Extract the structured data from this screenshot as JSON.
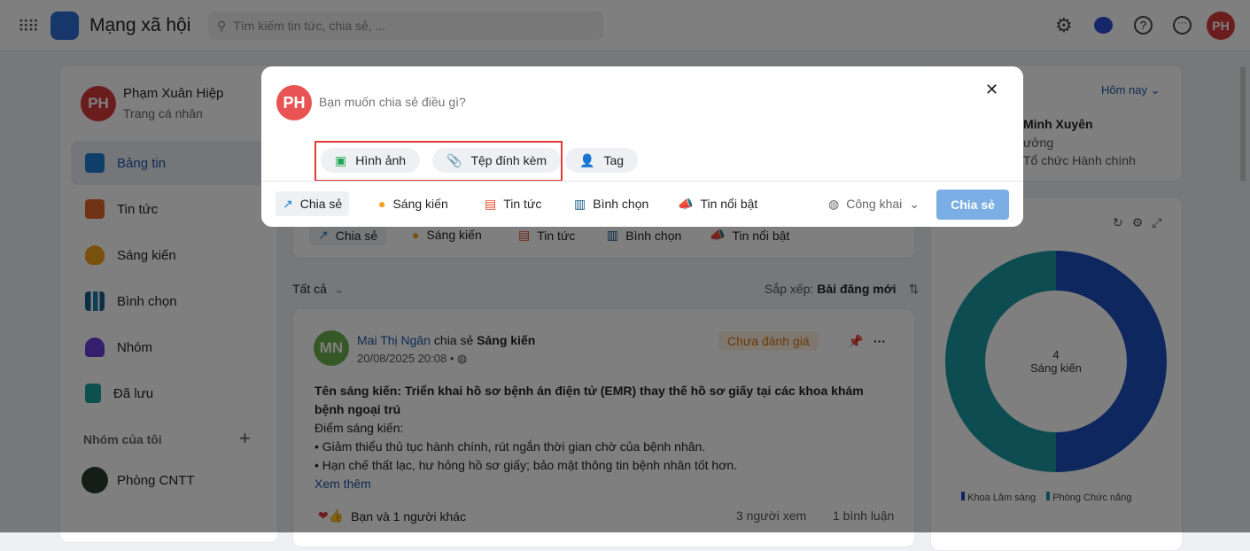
{
  "header": {
    "app_title": "Mạng xã hội",
    "search_placeholder": "Tìm kiếm tin tức, chia sẻ, ...",
    "user_initials": "PH"
  },
  "profile": {
    "name": "Phạm Xuân Hiệp",
    "subtitle": "Trang cá nhân",
    "initials": "PH"
  },
  "sidebar": {
    "items": [
      {
        "label": "Bảng tin"
      },
      {
        "label": "Tin tức"
      },
      {
        "label": "Sáng kiến"
      },
      {
        "label": "Bình chọn"
      },
      {
        "label": "Nhóm"
      },
      {
        "label": "Đã lưu"
      }
    ],
    "groups_title": "Nhóm của tôi",
    "groups": [
      {
        "label": "Phòng CNTT"
      }
    ]
  },
  "composer_bar": {
    "items": [
      "Chia sẻ",
      "Sáng kiến",
      "Tin tức",
      "Bình chọn",
      "Tin nổi bật"
    ]
  },
  "feed": {
    "filter": "Tất cả",
    "sort_label": "Sắp xếp:",
    "sort_value": "Bài đăng mới"
  },
  "post": {
    "initials": "MN",
    "author": "Mai Thị Ngân",
    "action": "chia sẻ",
    "type": "Sáng kiến",
    "time": "20/08/2025 20:08",
    "status": "Chưa đánh giá",
    "title": "Tên sáng kiến: Triển khai hồ sơ bệnh án điện tử (EMR) thay thế hồ sơ giấy tại các khoa khám bệnh ngoại trú",
    "lines": [
      "Điểm sáng kiến:",
      "• Giảm thiểu thủ tục hành chính, rút ngắn thời gian chờ của bệnh nhân.",
      "• Hạn chế thất lạc, hư hỏng hồ sơ giấy; bảo mật thông tin bệnh nhân tốt hơn."
    ],
    "more": "Xem thêm",
    "reactions": "Bạn và 1 người khác",
    "views": "3 người xem",
    "comments": "1 bình luận"
  },
  "right_card": {
    "period": "Hôm nay",
    "name": "Minh Xuyên",
    "role": "ưởng",
    "dept": "Tổ chức Hành chính"
  },
  "chart_data": {
    "type": "pie",
    "center_value": "4",
    "center_label": "Sáng kiến",
    "categories": [
      "Khoa Lâm sàng",
      "Phòng Chức năng"
    ],
    "values": [
      2,
      2
    ],
    "colors": [
      "#1f4fbf",
      "#1a9ba3"
    ]
  },
  "modal": {
    "initials": "PH",
    "placeholder": "Bạn muốn chia sẻ điều gì?",
    "attach": [
      "Hình ảnh",
      "Tệp đính kèm",
      "Tag"
    ],
    "types": [
      "Chia sẻ",
      "Sáng kiến",
      "Tin tức",
      "Bình chọn",
      "Tin nổi bật"
    ],
    "privacy": "Công khai",
    "submit": "Chia sẻ"
  }
}
